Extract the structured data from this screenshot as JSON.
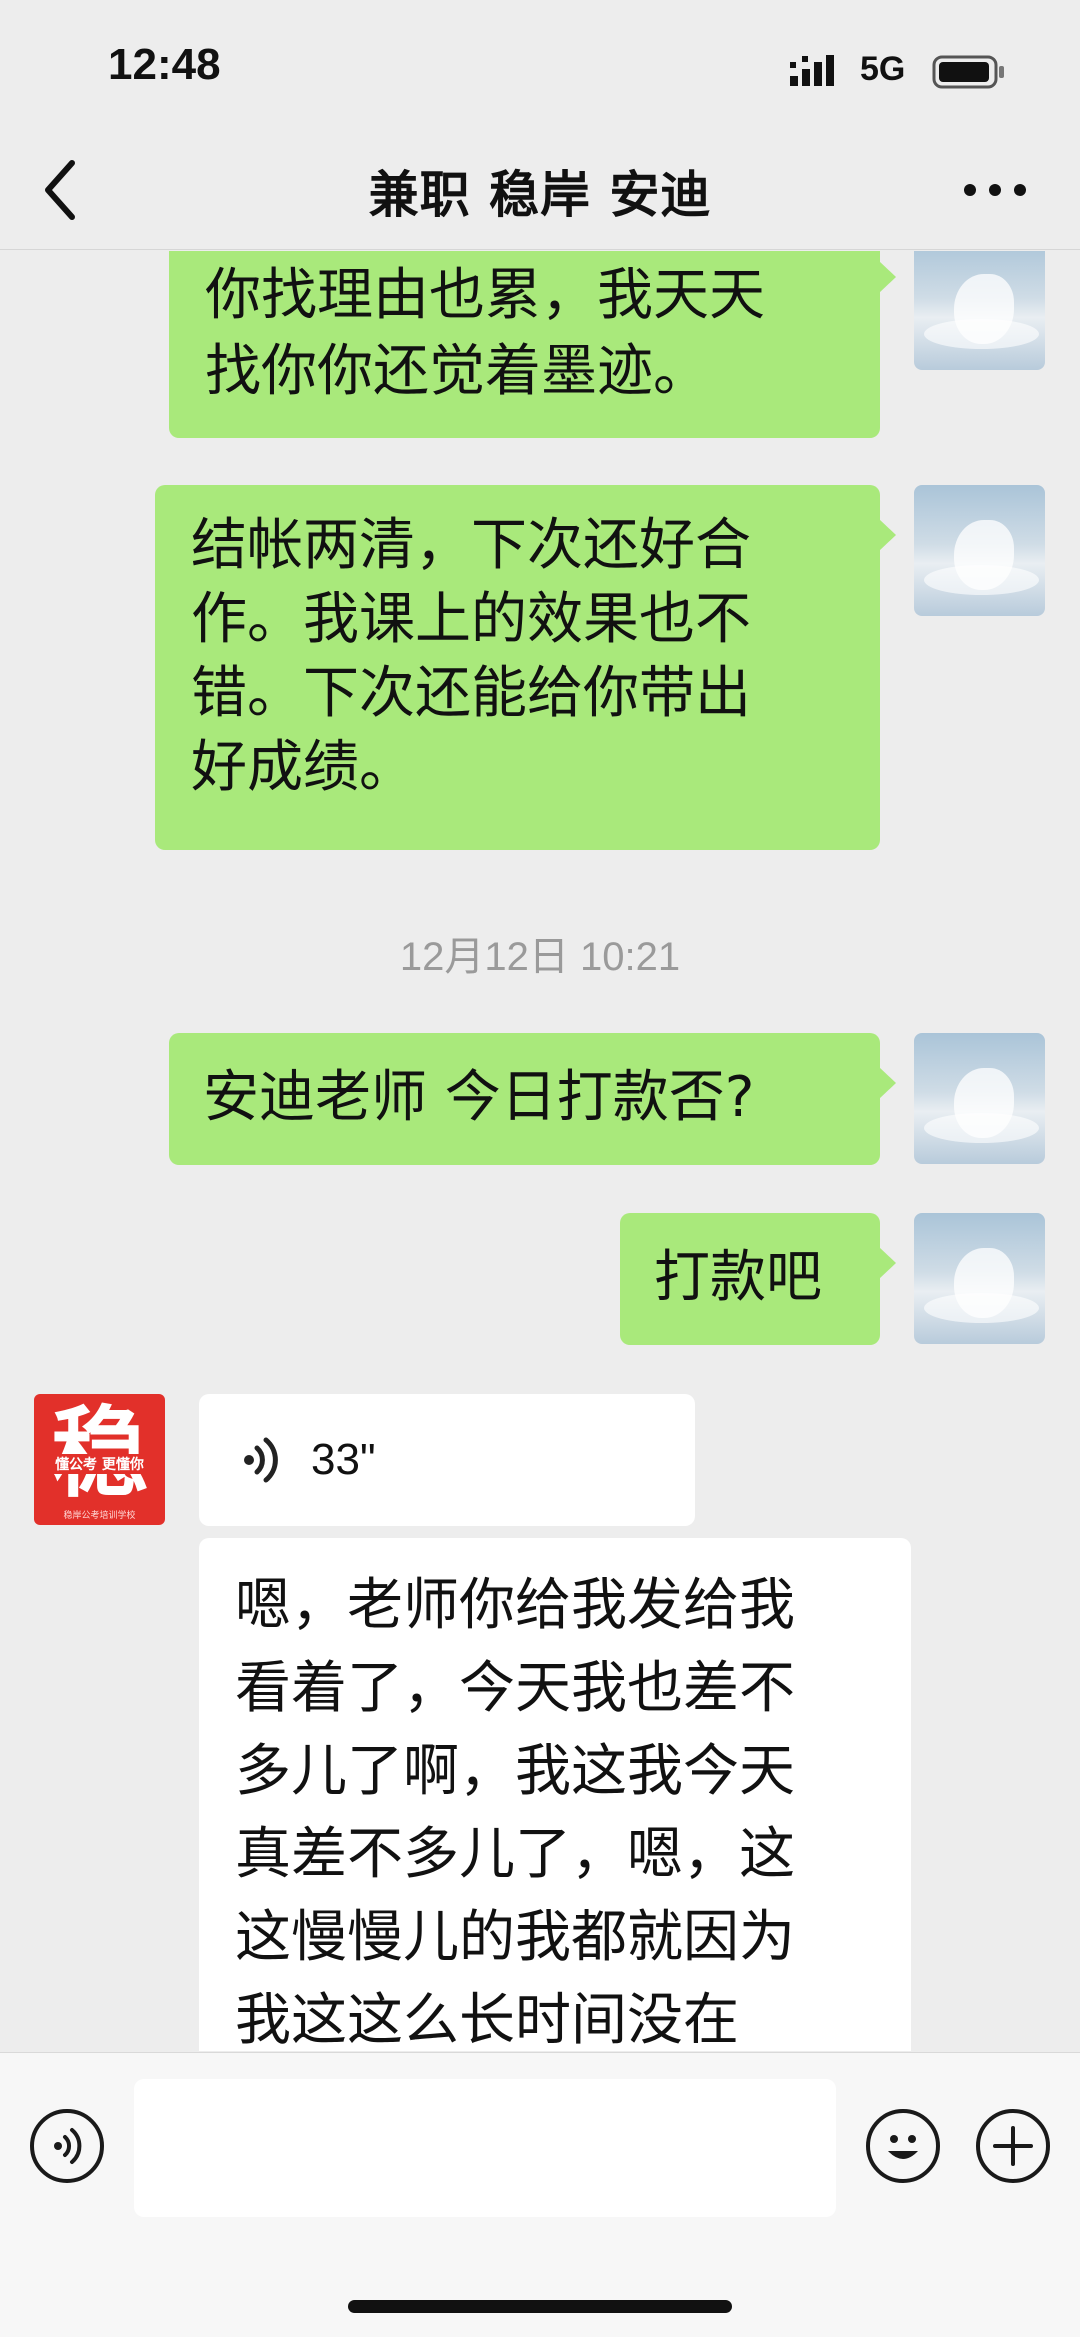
{
  "status": {
    "time": "12:48",
    "network": "5G"
  },
  "header": {
    "title": "兼职 稳岸 安迪"
  },
  "messages": {
    "m1": {
      "line1": "你找理由也累，我天天",
      "line2": "找你你还觉着墨迹。"
    },
    "m2": {
      "line1": "结帐两清，下次还好合",
      "line2": "作。我课上的效果也不",
      "line3": "错。下次还能给你带出",
      "line4": "好成绩。"
    },
    "timestamp": "12月12日 10:21",
    "m3": "安迪老师 今日打款否?",
    "m4": "打款吧",
    "voice": {
      "duration": "33\""
    },
    "m5": {
      "line1": "嗯，老师你给我发给我",
      "line2": "看着了，今天我也差不",
      "line3": "多儿了啊，我这我今天",
      "line4": "真差不多儿了，嗯，这",
      "line5": "这慢慢儿的我都就因为",
      "line6": "我这这么长时间没在"
    }
  },
  "logo": {
    "char": "稳",
    "band": "懂公考 更懂你",
    "foot": "稳岸公考培训学校"
  },
  "colors": {
    "bubble_me": "#a9e97b",
    "bubble_other": "#ffffff",
    "background": "#ededed",
    "logo": "#e2302a"
  },
  "icons": [
    "back-arrow-icon",
    "more-icon",
    "voice-icon",
    "emoji-icon",
    "add-icon",
    "signal-icon",
    "battery-icon"
  ]
}
